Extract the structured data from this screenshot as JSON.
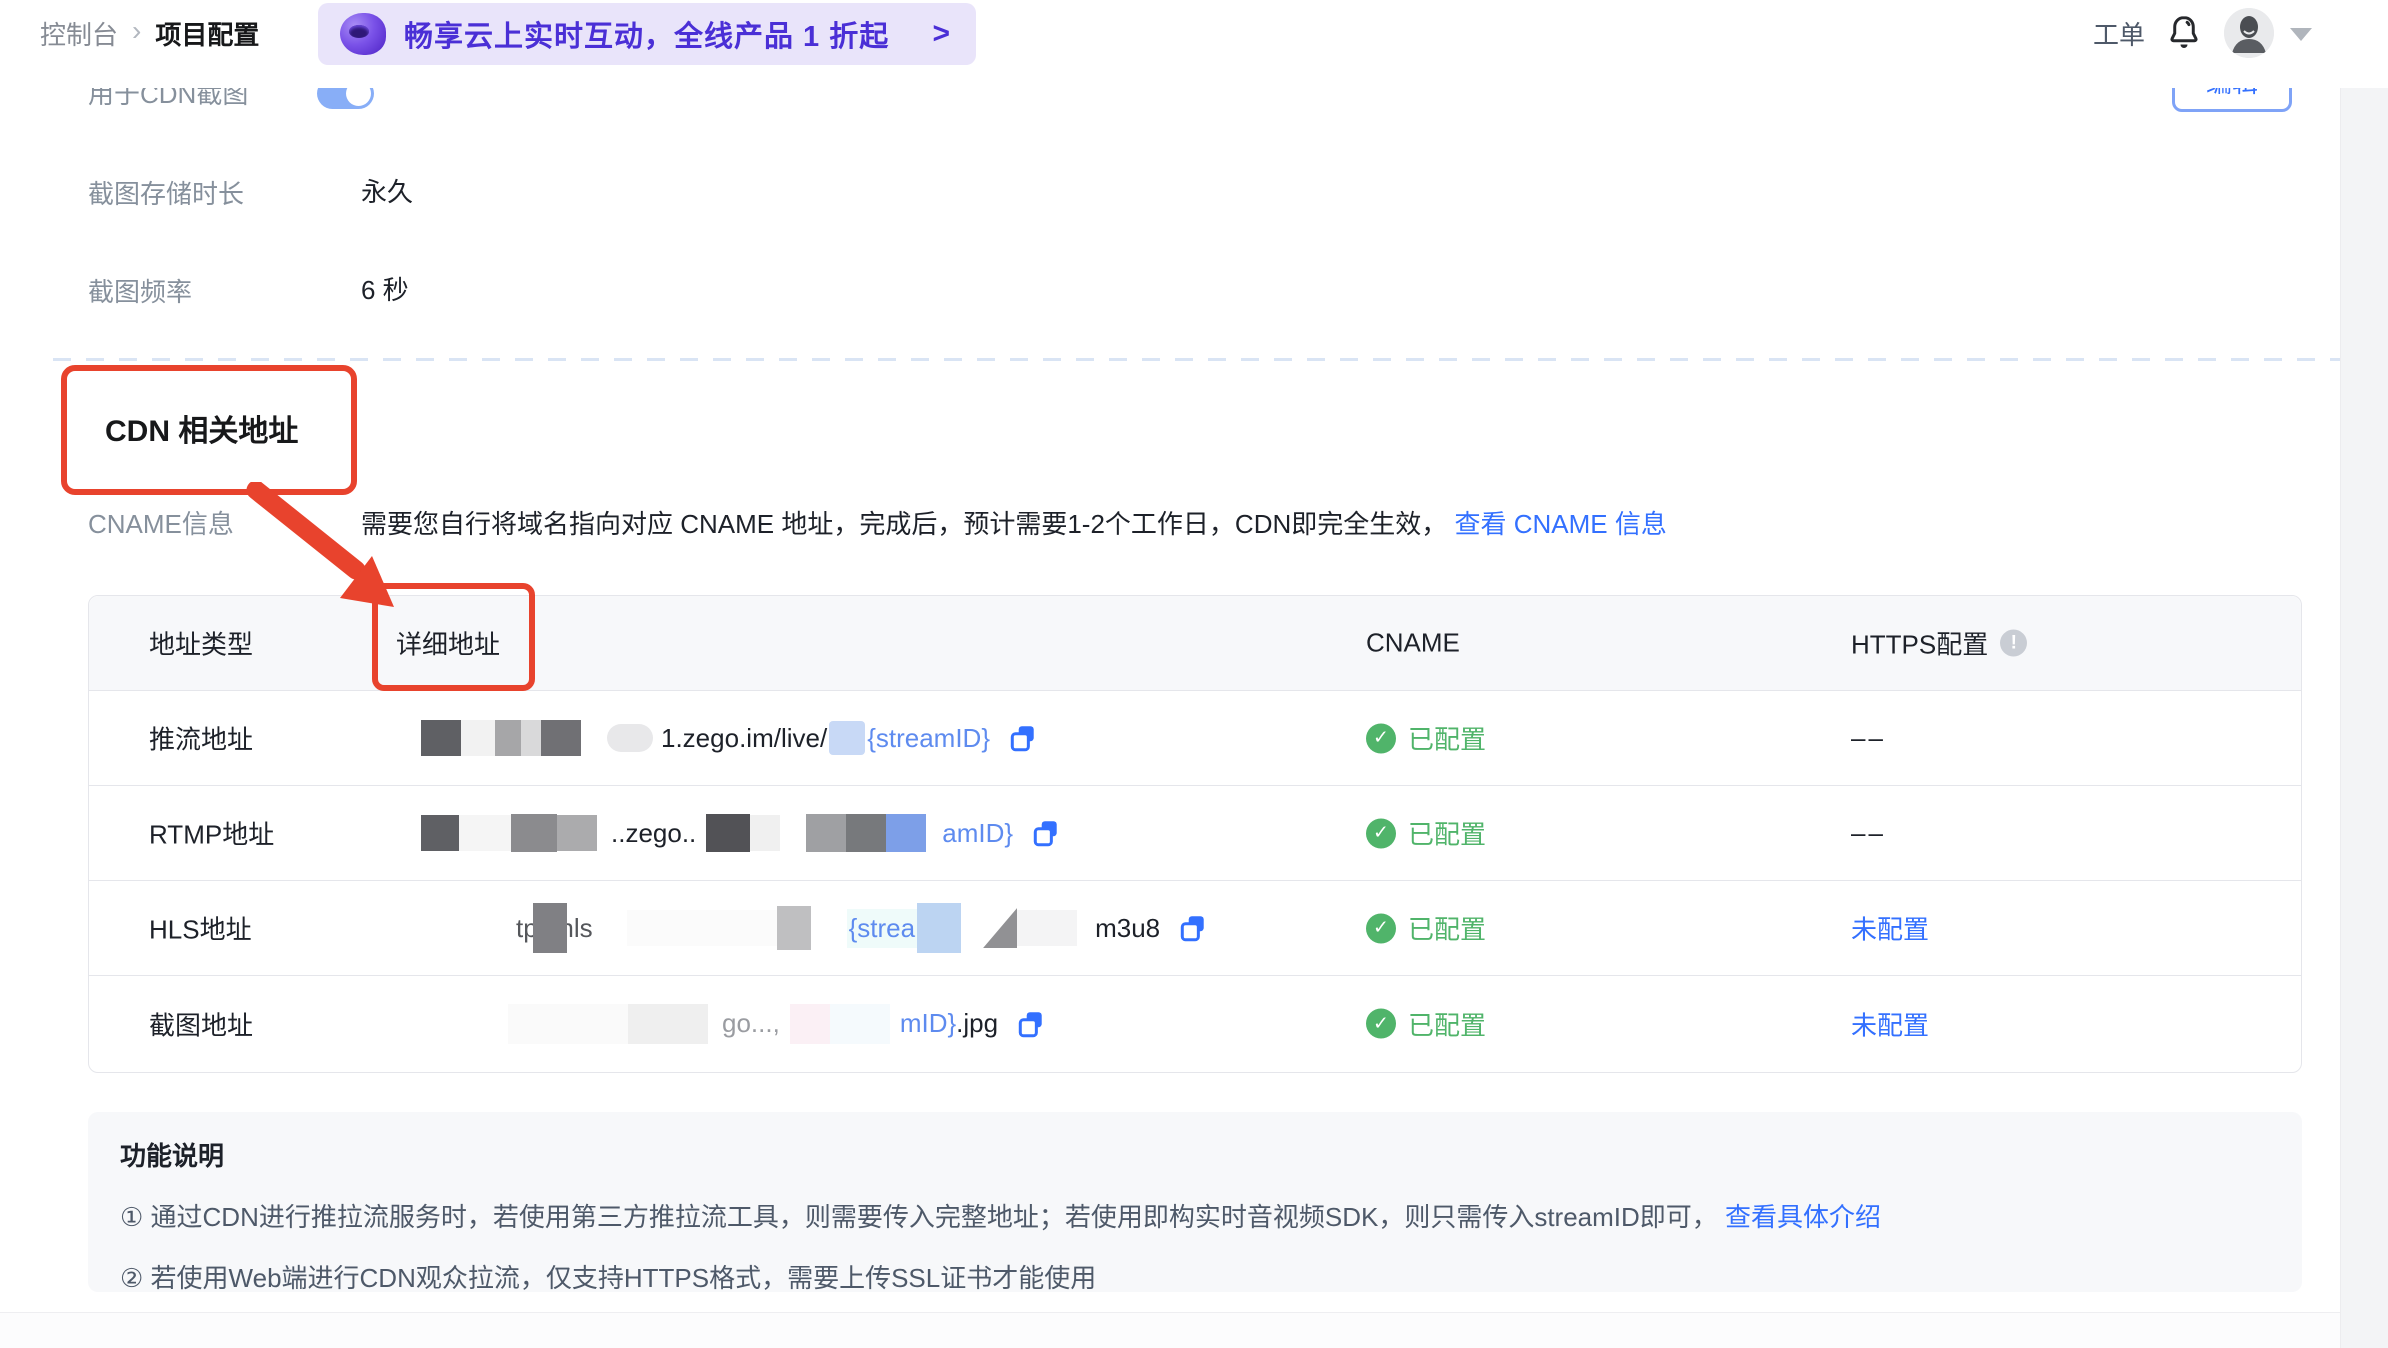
{
  "colors": {
    "accent_blue": "#3370FF",
    "url_blue": "#5E8BEF",
    "green_ok": "#50B46A",
    "red_annotation": "#E8432D",
    "banner_purple": "#4A2FD6",
    "banner_bg": "#E9E4FA",
    "toggle_on": "#88AEF7"
  },
  "icons": {
    "check": "✓",
    "info": "!",
    "breadcrumb_sep": "›"
  },
  "topbar": {
    "breadcrumb": {
      "root": "控制台",
      "current": "项目配置"
    },
    "banner": {
      "text": "畅享云上实时互动，全线产品 1 折起",
      "arrow": ">"
    },
    "ticket": "工单"
  },
  "form": {
    "edit_button": "编辑",
    "rows": [
      {
        "label": "用于CDN截图",
        "type": "toggle",
        "state": "on"
      },
      {
        "label": "截图存储时长",
        "value": "永久"
      },
      {
        "label": "截图频率",
        "value": "6 秒"
      }
    ]
  },
  "section": {
    "title": "CDN 相关地址",
    "cname_label": "CNAME信息",
    "cname_desc": "需要您自行将域名指向对应 CNAME 地址，完成后，预计需要1-2个工作日，CDN即完全生效，",
    "cname_link": "查看 CNAME 信息"
  },
  "table": {
    "headers": [
      "地址类型",
      "详细地址",
      "CNAME",
      "HTTPS配置"
    ],
    "rows": [
      {
        "type": "推流地址",
        "url_dark": "1.zego.im/live/",
        "url_blue": "{streamID}",
        "url_end": "",
        "cname": "已配置",
        "https": "––"
      },
      {
        "type": "RTMP地址",
        "url_dark": "..zego..",
        "url_blue": "amID}",
        "url_end": "",
        "cname": "已配置",
        "https": "––"
      },
      {
        "type": "HLS地址",
        "url_dark": "tp://hls",
        "url_blue": "{strea",
        "url_end": "m3u8",
        "cname": "已配置",
        "https": "未配置"
      },
      {
        "type": "截图地址",
        "url_gray": "go...,",
        "url_blue": "mID}",
        "url_end": ".jpg",
        "cname": "已配置",
        "https": "未配置"
      }
    ]
  },
  "notes": {
    "title": "功能说明",
    "line1": "① 通过CDN进行推拉流服务时，若使用第三方推拉流工具，则需要传入完整地址；若使用即构实时音视频SDK，则只需传入streamID即可，",
    "line1_link": "查看具体介绍",
    "line2": "② 若使用Web端进行CDN观众拉流，仅支持HTTPS格式，需要上传SSL证书才能使用"
  }
}
